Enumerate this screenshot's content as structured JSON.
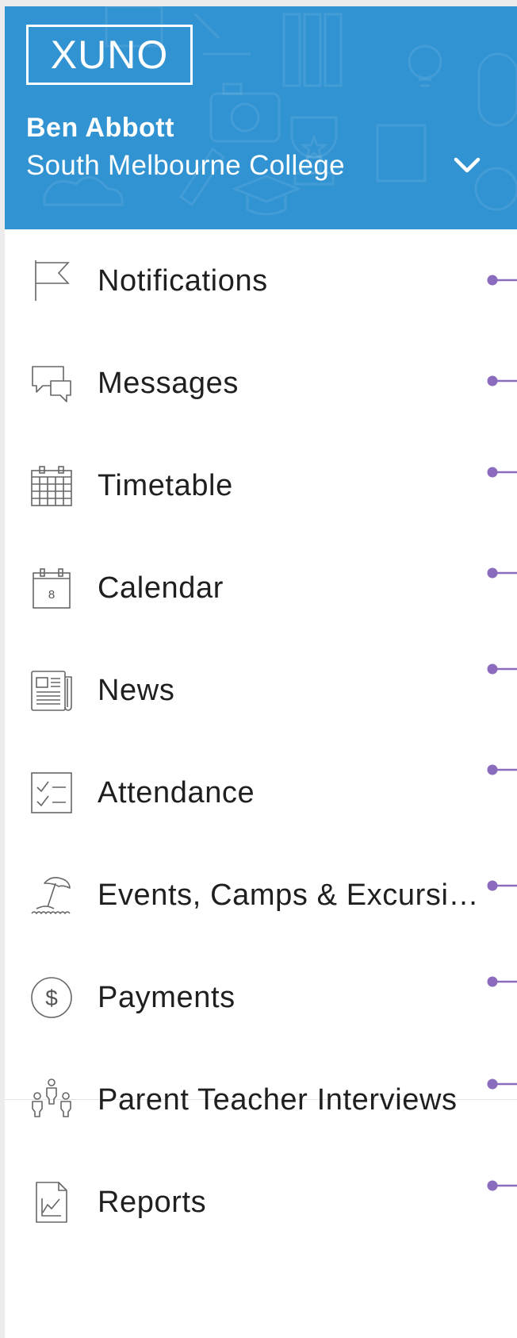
{
  "header": {
    "logo_text": "XUNO",
    "user_name": "Ben Abbott",
    "school_name": "South Melbourne College",
    "background_color": "#3193d1",
    "switch_icon": "chevron-down-icon"
  },
  "menu": {
    "items": [
      {
        "label": "Notifications",
        "icon": "flag-icon"
      },
      {
        "label": "Messages",
        "icon": "chat-bubbles-icon"
      },
      {
        "label": "Timetable",
        "icon": "timetable-grid-icon"
      },
      {
        "label": "Calendar",
        "icon": "calendar-icon"
      },
      {
        "label": "News",
        "icon": "newspaper-icon"
      },
      {
        "label": "Attendance",
        "icon": "checklist-icon"
      },
      {
        "label": "Events, Camps & Excursi…",
        "icon": "beach-umbrella-icon"
      },
      {
        "label": "Payments",
        "icon": "dollar-coin-icon"
      },
      {
        "label": "Parent Teacher Interviews",
        "icon": "people-meeting-icon"
      },
      {
        "label": "Reports",
        "icon": "report-chart-icon"
      }
    ],
    "calendar_icon_day": "8",
    "payments_icon_symbol": "$",
    "text_color": "#1f1f1f",
    "connector_color": "#8a6bbd"
  }
}
